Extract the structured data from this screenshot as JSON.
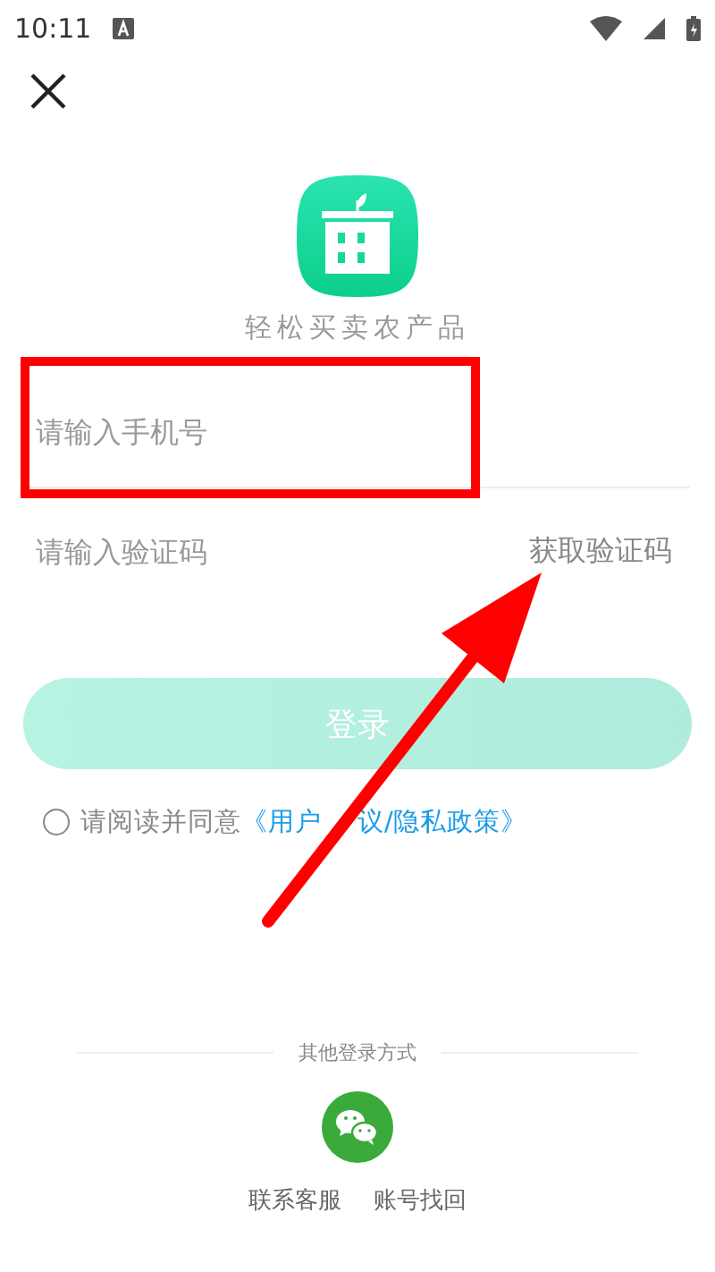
{
  "status_bar": {
    "time": "10:11"
  },
  "app": {
    "title": "轻松买卖农产品"
  },
  "phone_field": {
    "placeholder": "请输入手机号"
  },
  "code_field": {
    "placeholder": "请输入验证码",
    "action": "获取验证码"
  },
  "login_button": {
    "label": "登录",
    "disabled": true
  },
  "agreement": {
    "checked": false,
    "text": "请阅读并同意",
    "link_parts": [
      "《用户",
      "议/隐私政策》"
    ]
  },
  "other_login": {
    "title": "其他登录方式"
  },
  "footer_links": [
    "联系客服",
    "账号找回"
  ],
  "annotations": {
    "highlight_frame": true,
    "pointer_arrow": true
  }
}
